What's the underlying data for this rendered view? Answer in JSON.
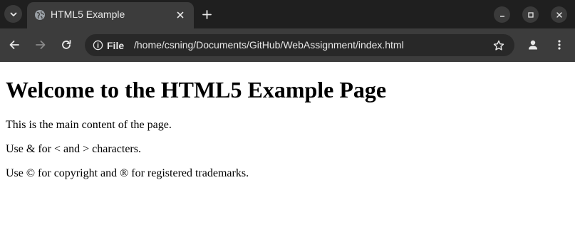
{
  "browser": {
    "tab": {
      "title": "HTML5 Example"
    },
    "address": {
      "scheme_label": "File",
      "url": "/home/csning/Documents/GitHub/WebAssignment/index.html"
    }
  },
  "page": {
    "heading": "Welcome to the HTML5 Example Page",
    "paragraphs": [
      "This is the main content of the page.",
      "Use & for < and > characters.",
      "Use © for copyright and ® for registered trademarks."
    ]
  },
  "icons": {
    "tab_search": "chevron-down-icon",
    "favicon": "globe-icon",
    "tab_close": "close-icon",
    "new_tab": "plus-icon",
    "minimize": "minimize-icon",
    "maximize": "maximize-icon",
    "close_window": "close-icon",
    "back": "arrow-left-icon",
    "forward": "arrow-right-icon",
    "reload": "reload-icon",
    "site_info": "info-icon",
    "bookmark": "star-icon",
    "profile": "person-icon",
    "menu": "kebab-menu-icon"
  },
  "colors": {
    "tabstrip_bg": "#1f1f1f",
    "toolbar_bg": "#3c3c3c",
    "omnibox_bg": "#282828",
    "page_bg": "#ffffff"
  }
}
